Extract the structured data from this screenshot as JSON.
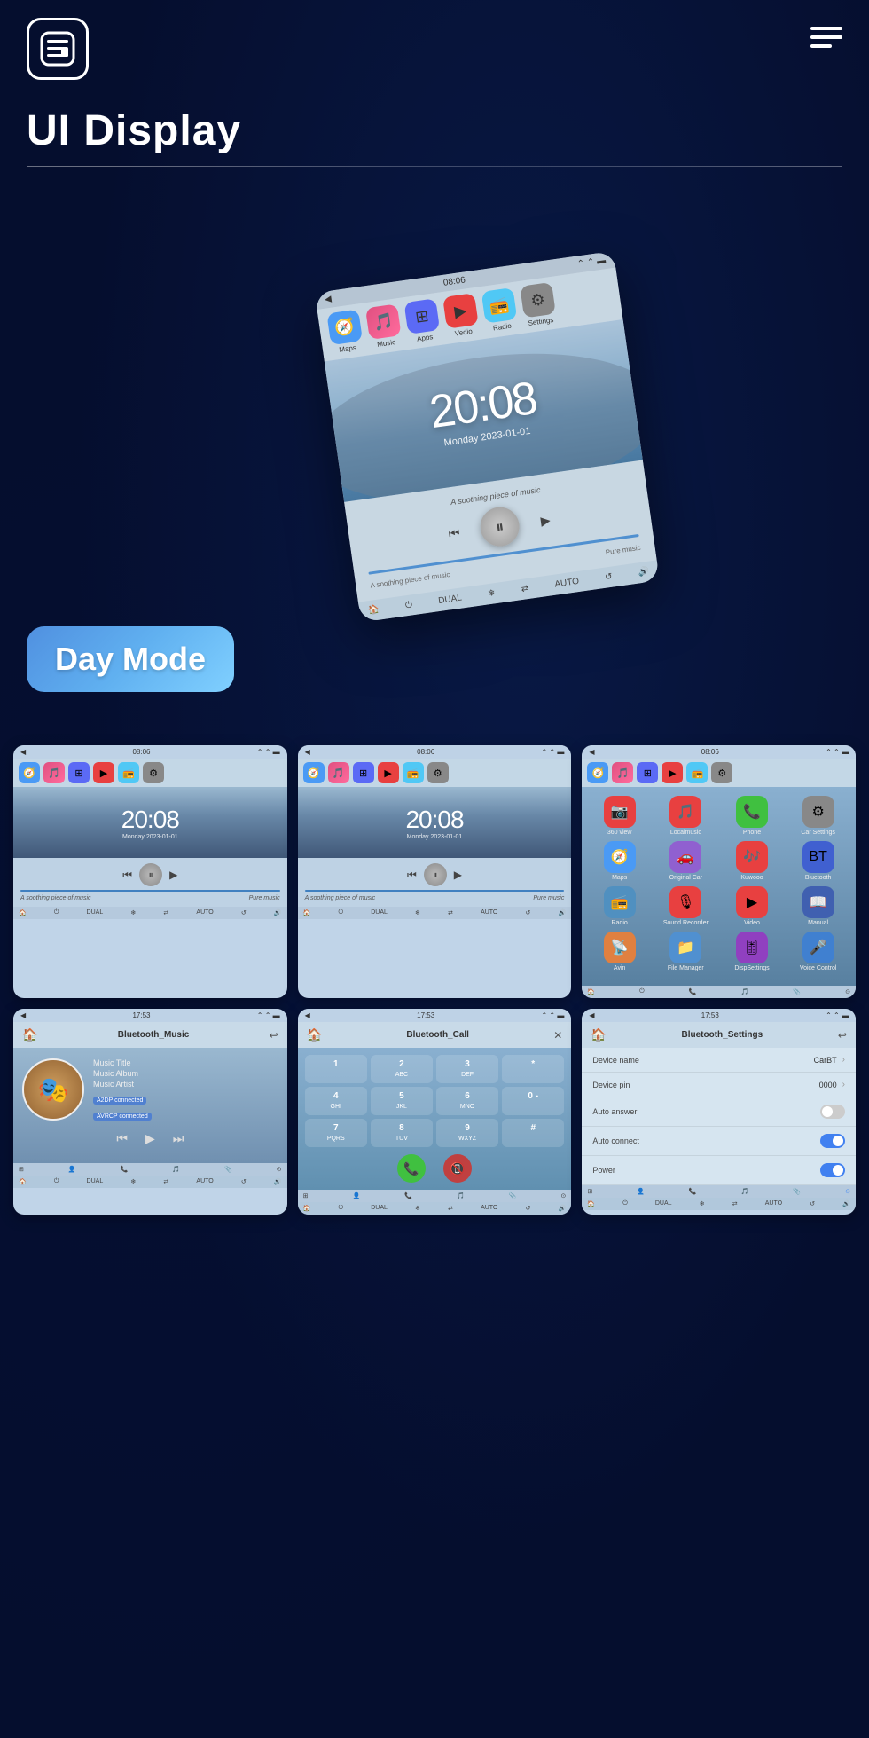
{
  "header": {
    "logo_label": "Menu",
    "title": "UI Display",
    "hamburger_label": "Navigation menu"
  },
  "hero": {
    "time": "20:08",
    "date": "Monday  2023-01-01",
    "song": "A soothing piece of music",
    "genre": "Pure music",
    "mode_badge": "Day Mode",
    "status_time": "08:06",
    "apps": [
      "Maps",
      "Music",
      "Apps",
      "Vedio",
      "Radio",
      "Settings"
    ]
  },
  "grid1": {
    "left": {
      "status_time": "08:06",
      "time": "20:08",
      "date": "Monday  2023-01-01",
      "song": "A soothing piece of music",
      "genre": "Pure music"
    },
    "center": {
      "status_time": "08:06",
      "time": "20:08",
      "date": "Monday  2023-01-01",
      "song": "A soothing piece of music",
      "genre": "Pure music"
    },
    "right": {
      "status_time": "08:06",
      "apps": [
        {
          "name": "360 view",
          "color": "#e84040"
        },
        {
          "name": "Localmusic",
          "color": "#e84040"
        },
        {
          "name": "Phone",
          "color": "#40c040"
        },
        {
          "name": "Car Settings",
          "color": "#888"
        },
        {
          "name": "Maps",
          "color": "#4a9af5"
        },
        {
          "name": "Original Car",
          "color": "#9060d0"
        },
        {
          "name": "Kuwooo",
          "color": "#e84040"
        },
        {
          "name": "Bluetooth",
          "color": "#4060d0"
        },
        {
          "name": "Radio",
          "color": "#5090c0"
        },
        {
          "name": "Sound Recorder",
          "color": "#e84040"
        },
        {
          "name": "Video",
          "color": "#e84040"
        },
        {
          "name": "Manual",
          "color": "#4060b0"
        },
        {
          "name": "Avin",
          "color": "#e08040"
        },
        {
          "name": "File Manager",
          "color": "#5090d0"
        },
        {
          "name": "DispSettings",
          "color": "#9040c0"
        },
        {
          "name": "Voice Control",
          "color": "#4080d0"
        }
      ]
    }
  },
  "grid2": {
    "left": {
      "status_time": "17:53",
      "title": "Bluetooth_Music",
      "music_title": "Music Title",
      "music_album": "Music Album",
      "music_artist": "Music Artist",
      "badge1": "A2DP connected",
      "badge2": "AVRCP connected"
    },
    "center": {
      "status_time": "17:53",
      "title": "Bluetooth_Call",
      "dial_keys": [
        "1",
        "2 ABC",
        "3 DEF",
        "*",
        "4 GHI",
        "5 JKL",
        "6 MNO",
        "0 -",
        "7 PQRS",
        "8 TUV",
        "9 WXYZ",
        "#"
      ]
    },
    "right": {
      "status_time": "17:53",
      "title": "Bluetooth_Settings",
      "settings": [
        {
          "label": "Device name",
          "value": "CarBT",
          "type": "nav"
        },
        {
          "label": "Device pin",
          "value": "0000",
          "type": "nav"
        },
        {
          "label": "Auto answer",
          "value": "",
          "type": "toggle_off"
        },
        {
          "label": "Auto connect",
          "value": "",
          "type": "toggle_on"
        },
        {
          "label": "Power",
          "value": "",
          "type": "toggle_on"
        }
      ]
    }
  }
}
